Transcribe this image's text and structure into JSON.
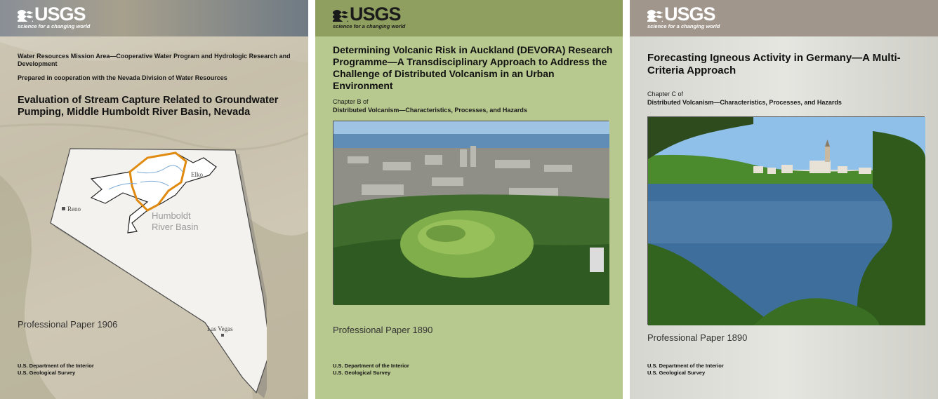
{
  "logo": {
    "wordmark": "USGS",
    "tagline": "science for a changing world"
  },
  "covers": [
    {
      "mission": "Water Resources Mission Area—Cooperative Water Program and Hydrologic Research and Development",
      "cooperation": "Prepared in cooperation with the Nevada Division of Water Resources",
      "title": "Evaluation of Stream Capture Related to Groundwater Pumping, Middle Humboldt River Basin, Nevada",
      "map_labels": {
        "city_1": "Reno",
        "city_2": "Elko",
        "city_3": "Las Vegas",
        "basin": "Humboldt River Basin"
      },
      "series": "Professional Paper 1906",
      "agency_1": "U.S. Department of the Interior",
      "agency_2": "U.S. Geological Survey"
    },
    {
      "title": "Determining Volcanic Risk in Auckland (DEVORA) Research Programme—A Transdisciplinary Approach to Address the Challenge of Distributed Volcanism in an Urban Environment",
      "chapter": "Chapter B of",
      "volume": "Distributed Volcanism—Characteristics, Processes, and Hazards",
      "photo_icon": "volcano-city-aerial-photo",
      "series": "Professional Paper 1890",
      "agency_1": "U.S. Department of the Interior",
      "agency_2": "U.S. Geological Survey"
    },
    {
      "title": "Forecasting Igneous Activity in Germany—A Multi-Criteria Approach",
      "chapter": "Chapter C of",
      "volume": "Distributed Volcanism—Characteristics, Processes, and Hazards",
      "photo_icon": "lake-village-photo",
      "series": "Professional Paper 1890",
      "agency_1": "U.S. Department of the Interior",
      "agency_2": "U.S. Geological Survey"
    }
  ],
  "colors": {
    "cover_1_bg": "#cfc8b5",
    "cover_2_bg": "#b8c98f",
    "cover_3_bg": "#e0e0da",
    "basin_outline": "#e08a10"
  }
}
